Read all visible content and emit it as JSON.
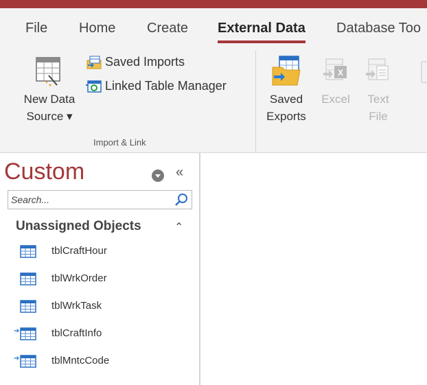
{
  "colors": {
    "accent": "#a4373a",
    "ribbon_bg": "#f3f3f3",
    "disabled_text": "#b3b3b3",
    "table_icon_blue": "#2b6fc2"
  },
  "tabs": [
    {
      "label": "File",
      "active": false
    },
    {
      "label": "Home",
      "active": false
    },
    {
      "label": "Create",
      "active": false
    },
    {
      "label": "External Data",
      "active": true
    },
    {
      "label": "Database Too",
      "active": false
    }
  ],
  "ribbon": {
    "import_link_group": {
      "new_data_source": {
        "line1": "New Data",
        "line2": "Source ▾",
        "icon": "table-new-icon"
      },
      "saved_imports": {
        "label": "Saved Imports",
        "icon": "saved-imports-icon"
      },
      "linked_table_manager": {
        "label": "Linked Table Manager",
        "icon": "linked-table-icon"
      },
      "group_label": "Import & Link"
    },
    "export_group": {
      "saved_exports": {
        "line1": "Saved",
        "line2": "Exports",
        "icon": "folder-table-icon",
        "enabled": true
      },
      "excel": {
        "label": "Excel",
        "icon": "excel-icon",
        "enabled": false
      },
      "text_file": {
        "line1": "Text",
        "line2": "File",
        "icon": "text-file-icon",
        "enabled": false
      }
    }
  },
  "nav_pane": {
    "title": "Custom",
    "menu_icon": "dropdown-circle-icon",
    "collapse_label": "«",
    "search": {
      "placeholder": "Search...",
      "value": ""
    },
    "group": {
      "label": "Unassigned Objects",
      "toggle": "⌃"
    },
    "items": [
      {
        "label": "tblCraftHour",
        "linked": false,
        "icon": "table-icon"
      },
      {
        "label": "tblWrkOrder",
        "linked": false,
        "icon": "table-icon"
      },
      {
        "label": "tblWrkTask",
        "linked": false,
        "icon": "table-icon"
      },
      {
        "label": "tblCraftInfo",
        "linked": true,
        "icon": "linked-table-icon"
      },
      {
        "label": "tblMntcCode",
        "linked": true,
        "icon": "linked-table-icon"
      }
    ]
  }
}
